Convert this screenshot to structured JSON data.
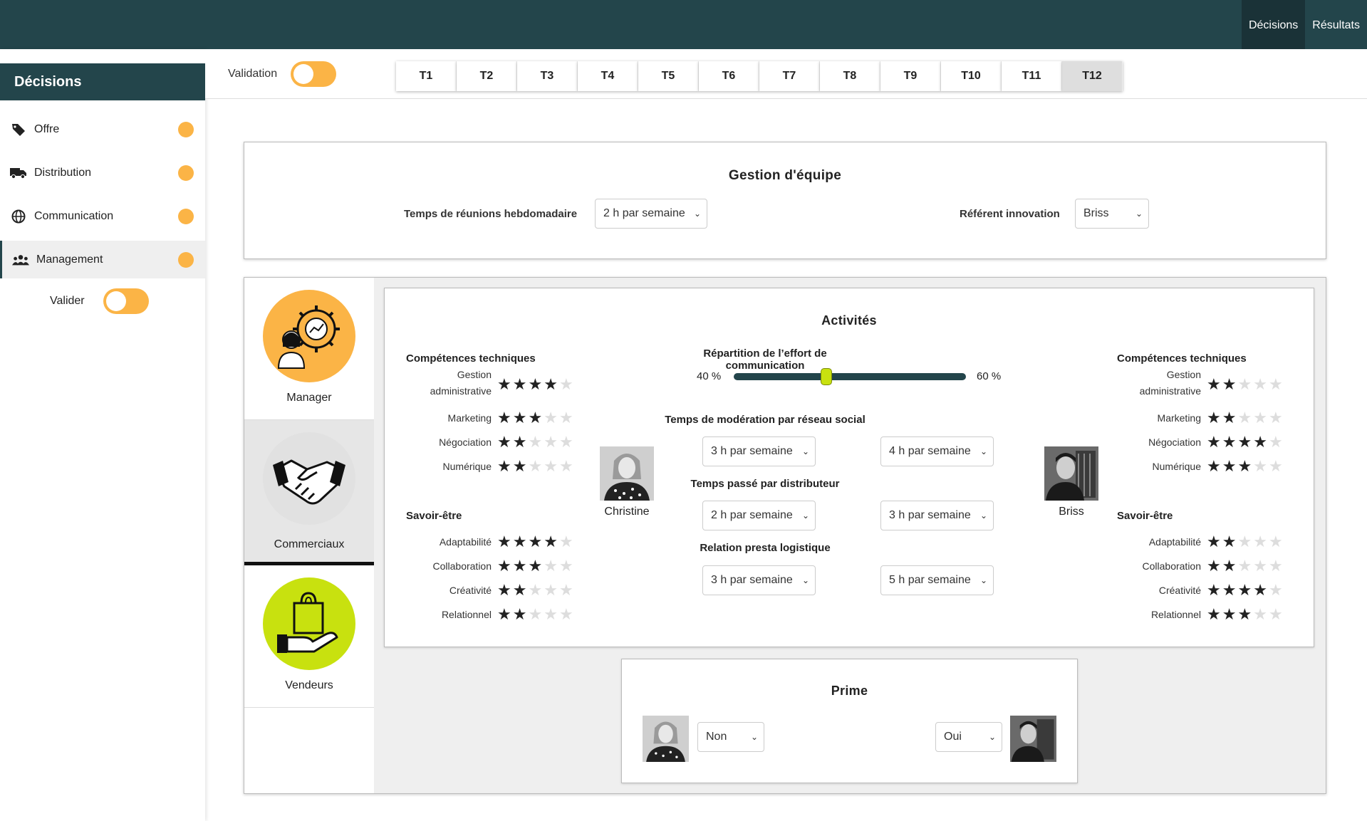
{
  "topnav": {
    "decisions": "Décisions",
    "resultats": "Résultats"
  },
  "sidebar": {
    "title": "Décisions",
    "items": [
      {
        "label": "Offre",
        "icon": "tag-icon"
      },
      {
        "label": "Distribution",
        "icon": "truck-icon"
      },
      {
        "label": "Communication",
        "icon": "globe-icon"
      },
      {
        "label": "Management",
        "icon": "users-icon"
      }
    ],
    "valider_label": "Valider",
    "status_color": "#fbb446"
  },
  "validation": {
    "label": "Validation"
  },
  "tabs": [
    "T1",
    "T2",
    "T3",
    "T4",
    "T5",
    "T6",
    "T7",
    "T8",
    "T9",
    "T10",
    "T11",
    "T12"
  ],
  "selected_tab": "T12",
  "gestion": {
    "title": "Gestion d'équipe",
    "reunions_label": "Temps de réunions hebdomadaire",
    "reunions_value": "2 h par semaine",
    "referent_label": "Référent innovation",
    "referent_value": "Briss"
  },
  "roles": [
    {
      "label": "Manager",
      "icon": "manager-icon",
      "color": "#fbb446"
    },
    {
      "label": "Commerciaux",
      "icon": "handshake-icon",
      "color": "#e6e6e6"
    },
    {
      "label": "Vendeurs",
      "icon": "shopping-bag-hand-icon",
      "color": "#c8e10f"
    }
  ],
  "activites": {
    "title": "Activités",
    "comp_tech": "Compétences techniques",
    "savoir_etre": "Savoir-être",
    "left": {
      "name": "Christine",
      "tech": [
        {
          "label": "Gestion administrative",
          "stars": 4
        },
        {
          "label": "Marketing",
          "stars": 3
        },
        {
          "label": "Négociation",
          "stars": 2
        },
        {
          "label": "Numérique",
          "stars": 2
        }
      ],
      "soft": [
        {
          "label": "Adaptabilité",
          "stars": 4
        },
        {
          "label": "Collaboration",
          "stars": 3
        },
        {
          "label": "Créativité",
          "stars": 2
        },
        {
          "label": "Relationnel",
          "stars": 2
        }
      ]
    },
    "right": {
      "name": "Briss",
      "tech": [
        {
          "label": "Gestion administrative",
          "stars": 2
        },
        {
          "label": "Marketing",
          "stars": 2
        },
        {
          "label": "Négociation",
          "stars": 4
        },
        {
          "label": "Numérique",
          "stars": 3
        }
      ],
      "soft": [
        {
          "label": "Adaptabilité",
          "stars": 2
        },
        {
          "label": "Collaboration",
          "stars": 2
        },
        {
          "label": "Créativité",
          "stars": 4
        },
        {
          "label": "Relationnel",
          "stars": 3
        }
      ]
    },
    "repartition_label": "Répartition de l’effort de communication",
    "repartition_left": "40 %",
    "repartition_right": "60 %",
    "repartition_value": 0.4,
    "moderation_label": "Temps de modération par réseau social",
    "moderation_left": "3 h par semaine",
    "moderation_right": "4 h par semaine",
    "distrib_label": "Temps passé par distributeur",
    "distrib_left": "2 h par semaine",
    "distrib_right": "3 h par semaine",
    "logistique_label": "Relation presta logistique",
    "logistique_left": "3 h par semaine",
    "logistique_right": "5 h par semaine"
  },
  "prime": {
    "title": "Prime",
    "left_value": "Non",
    "right_value": "Oui"
  }
}
